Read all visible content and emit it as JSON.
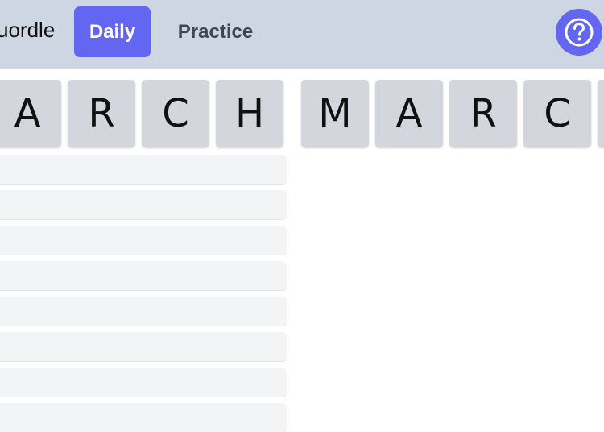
{
  "header": {
    "app_title": "uordle",
    "tabs": [
      {
        "label": "Daily",
        "active": true
      },
      {
        "label": "Practice",
        "active": false
      }
    ],
    "help_icon": "question-circle-icon"
  },
  "boards": [
    {
      "letters": [
        "A",
        "R",
        "C",
        "H"
      ],
      "empty_rows": 8
    },
    {
      "letters": [
        "M",
        "A",
        "R",
        "C",
        ""
      ],
      "empty_rows": 8
    }
  ],
  "colors": {
    "accent": "#6366f1",
    "header_bg": "#cdd6e2",
    "tile_bg": "#d3d7dd",
    "empty_row_bg": "#f3f4f5"
  }
}
